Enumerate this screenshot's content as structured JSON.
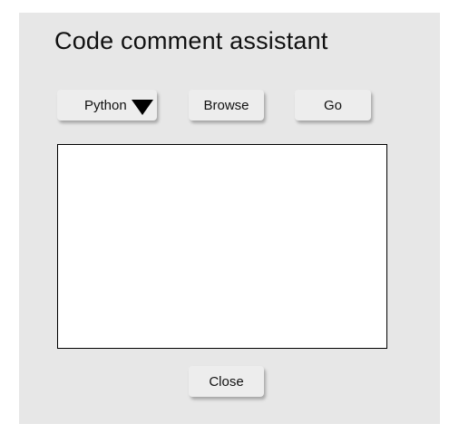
{
  "window": {
    "title": "Code comment assistant"
  },
  "toolbar": {
    "language_selected": "Python",
    "browse_label": "Browse",
    "go_label": "Go"
  },
  "editor": {
    "value": ""
  },
  "footer": {
    "close_label": "Close"
  },
  "icons": {
    "dropdown": "triangle-down-icon"
  },
  "colors": {
    "window_background": "#e7e7e7",
    "button_background": "#ededed",
    "text_area_background": "#ffffff",
    "text_area_border": "#000000"
  }
}
